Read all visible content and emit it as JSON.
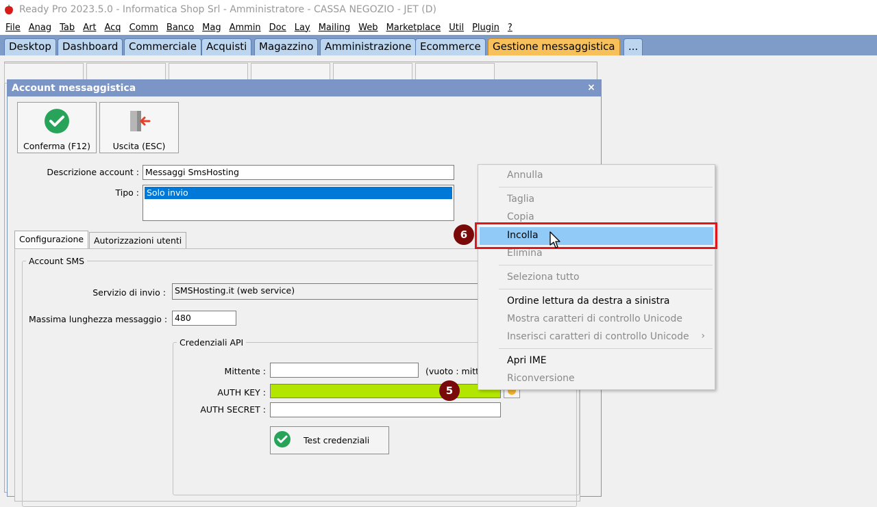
{
  "window": {
    "title": "Ready Pro 2023.5.0 - Informatica Shop Srl - Amministratore - CASSA NEGOZIO - JET (D)"
  },
  "menu": [
    "File",
    "Anag",
    "Tab",
    "Art",
    "Acq",
    "Comm",
    "Banco",
    "Mag",
    "Ammin",
    "Doc",
    "Lay",
    "Mailing",
    "Web",
    "Marketplace",
    "Util",
    "Plugin",
    "?"
  ],
  "module_tabs": [
    "Desktop",
    "Dashboard",
    "Commerciale",
    "Acquisti",
    "Magazzino",
    "Amministrazione",
    "Ecommerce",
    "Gestione messaggistica",
    "..."
  ],
  "dialog": {
    "title": "Account messaggistica",
    "close": "×",
    "confirm_label": "Conferma (F12)",
    "exit_label": "Uscita (ESC)",
    "descrizione_label": "Descrizione account :",
    "descrizione_value": "Messaggi SmsHosting",
    "tipo_label": "Tipo :",
    "tipo_selected": "Solo invio",
    "tabs": [
      "Configurazione",
      "Autorizzazioni utenti"
    ],
    "account_sms_group": "Account SMS",
    "servizio_label": "Servizio di invio :",
    "servizio_value": "SMSHosting.it (web service)",
    "max_len_label": "Massima lunghezza messaggio :",
    "max_len_value": "480",
    "credenziali_group": "Credenziali API",
    "mittente_label": "Mittente :",
    "mittente_value": "",
    "mittente_hint": "(vuoto : mitten",
    "auth_key_label": "AUTH KEY :",
    "auth_secret_label": "AUTH SECRET :",
    "test_button": "Test credenziali"
  },
  "badges": {
    "five": "5",
    "six": "6"
  },
  "context_menu": {
    "annulla": "Annulla",
    "taglia": "Taglia",
    "copia": "Copia",
    "incolla": "Incolla",
    "elimina": "Elimina",
    "seleziona_tutto": "Seleziona tutto",
    "ordine": "Ordine lettura da destra a sinistra",
    "mostra": "Mostra caratteri di controllo Unicode",
    "inserisci": "Inserisci caratteri di controllo Unicode",
    "apri_ime": "Apri IME",
    "riconversione": "Riconversione"
  },
  "colors": {
    "module_tab_active": "#f7c05a",
    "selection": "#0078d7",
    "auth_key_fill": "#b2e600",
    "highlight_box": "#e0161a",
    "badge": "#7a0a0a"
  }
}
